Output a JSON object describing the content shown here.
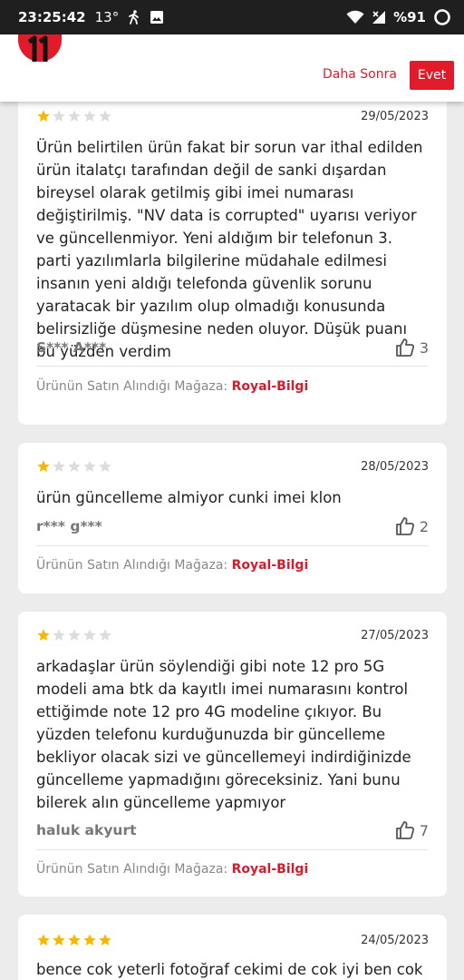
{
  "status_bar": {
    "time": "23:25:42",
    "temperature": "13°",
    "battery": "%91",
    "icons": [
      "walking-icon",
      "image-icon",
      "wifi-icon",
      "signal-icon",
      "battery-icon"
    ]
  },
  "promo": {
    "logo_icon": "n11-logo",
    "later_label": "Daha Sonra",
    "yes_label": "Evet"
  },
  "colors": {
    "accent": "#e11b2a",
    "star_filled": "#f5b700",
    "star_empty": "#dcdcdc"
  },
  "reviews": [
    {
      "rating": 1,
      "date": "29/05/2023",
      "text": "Ürün belirtilen ürün fakat bir sorun var ithal edilden ürün italatçı tarafından değil de sanki dışardan bireysel olarak getilmiş gibi imei numarası değiştirilmiş. \"NV data is corrupted\" uyarısı veriyor ve güncellenmiyor. Yeni aldığım bir telefonun 3. parti yazılımlarla bilgilerine müdahale edilmesi insanın yeni aldığı telefonda güvenlik sorunu yaratacak bir yazılım olup olmadığı konusunda belirsizliğe düşmesine neden oluyor. Düşük puanı bu yüzden verdim",
      "author": "S*** A***",
      "likes": "3",
      "store_label": "Ürünün Satın Alındığı Mağaza:",
      "store_name": "Royal-Bilgi"
    },
    {
      "rating": 1,
      "date": "28/05/2023",
      "text": "ürün güncelleme almiyor cunki imei klon",
      "author": "r*** g***",
      "likes": "2",
      "store_label": "Ürünün Satın Alındığı Mağaza:",
      "store_name": "Royal-Bilgi"
    },
    {
      "rating": 1,
      "date": "27/05/2023",
      "text": "arkadaşlar ürün söylendiği gibi note 12 pro 5G modeli ama btk da kayıtlı imei numarasını kontrol ettiğimde note 12 pro 4G modeline çıkıyor. Bu yüzden telefonu kurduğunuzda bir güncelleme bekliyor olacak sizi ve güncellemeyi indirdiğinizde güncelleme yapmadığını göreceksiniz. Yani bunu bilerek alın güncelleme yapmıyor",
      "author": "haluk akyurt",
      "likes": "7",
      "store_label": "Ürünün Satın Alındığı Mağaza:",
      "store_name": "Royal-Bilgi"
    },
    {
      "rating": 5,
      "date": "24/05/2023",
      "text": "bence cok yeterli fotoğraf cekimi de cok iyi ben cok"
    }
  ]
}
